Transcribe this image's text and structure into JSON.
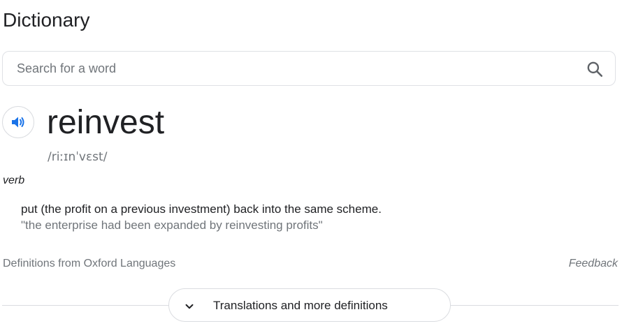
{
  "header": {
    "title": "Dictionary"
  },
  "search": {
    "placeholder": "Search for a word",
    "value": "",
    "icon": "search-icon"
  },
  "entry": {
    "speaker_icon": "speaker-icon",
    "word": "reinvest",
    "phonetic": "/riːɪnˈvɛst/",
    "part_of_speech": "verb",
    "definition": "put (the profit on a previous investment) back into the same scheme.",
    "example": "\"the enterprise had been expanded by reinvesting profits\""
  },
  "footer": {
    "source": "Definitions from Oxford Languages",
    "feedback": "Feedback"
  },
  "more": {
    "label": "Translations and more definitions",
    "icon": "chevron-down-icon"
  },
  "colors": {
    "text_primary": "#202124",
    "text_secondary": "#70757a",
    "border": "#dfe1e5",
    "speaker_blue": "#1a73e8"
  }
}
